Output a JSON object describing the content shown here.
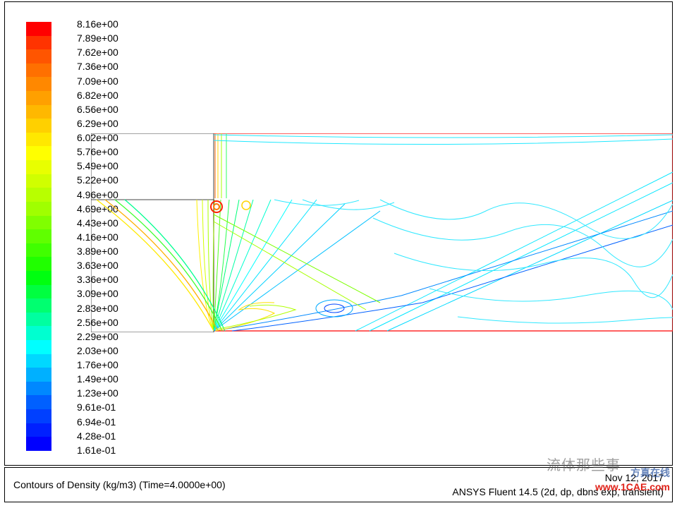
{
  "chart_data": {
    "type": "heatmap",
    "title": "Contours of Density (kg/m3)  (Time=4.0000e+00)",
    "software_line": "ANSYS Fluent 14.5 (2d, dp, dbns exp, transient)",
    "date": "Nov 12, 2017",
    "scale_labels": [
      "8.16e+00",
      "7.89e+00",
      "7.62e+00",
      "7.36e+00",
      "7.09e+00",
      "6.82e+00",
      "6.56e+00",
      "6.29e+00",
      "6.02e+00",
      "5.76e+00",
      "5.49e+00",
      "5.22e+00",
      "4.96e+00",
      "4.69e+00",
      "4.43e+00",
      "4.16e+00",
      "3.89e+00",
      "3.63e+00",
      "3.36e+00",
      "3.09e+00",
      "2.83e+00",
      "2.56e+00",
      "2.29e+00",
      "2.03e+00",
      "1.76e+00",
      "1.49e+00",
      "1.23e+00",
      "9.61e-01",
      "6.94e-01",
      "4.28e-01",
      "1.61e-01"
    ],
    "scale_numeric": [
      8.16,
      7.89,
      7.62,
      7.36,
      7.09,
      6.82,
      6.56,
      6.29,
      6.02,
      5.76,
      5.49,
      5.22,
      4.96,
      4.69,
      4.43,
      4.16,
      3.89,
      3.63,
      3.36,
      3.09,
      2.83,
      2.56,
      2.29,
      2.03,
      1.76,
      1.49,
      1.23,
      0.961,
      0.694,
      0.428,
      0.161
    ],
    "scale_colors": [
      "#ff0000",
      "#ff3300",
      "#ff5500",
      "#ff7000",
      "#ff8800",
      "#ffa000",
      "#ffb800",
      "#ffd000",
      "#ffe800",
      "#ffff00",
      "#e8ff00",
      "#d0ff00",
      "#b8ff00",
      "#a0ff00",
      "#80ff00",
      "#60ff00",
      "#40ff00",
      "#20ff00",
      "#00ff10",
      "#00ff40",
      "#00ff70",
      "#00ffa0",
      "#00ffd0",
      "#00ffff",
      "#00d8ff",
      "#00b0ff",
      "#0088ff",
      "#0060ff",
      "#0040ff",
      "#0020ff",
      "#0000ff"
    ],
    "range": {
      "min": 0.161,
      "max": 8.16,
      "unit": "kg/m3"
    }
  },
  "watermarks": {
    "wm1": "流体那些事",
    "wm2": "方真在线",
    "wm3": "www.1CAE.com"
  }
}
